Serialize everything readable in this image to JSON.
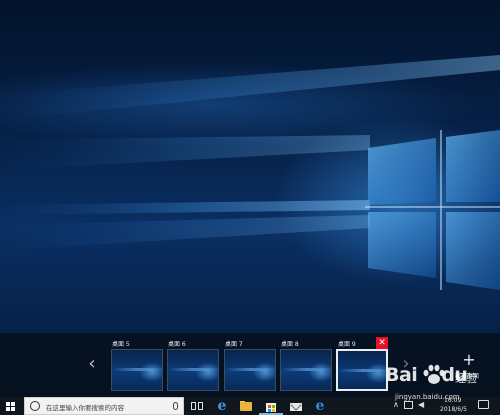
{
  "task_view": {
    "desktops": [
      {
        "label": "桌面 5",
        "selected": false
      },
      {
        "label": "桌面 6",
        "selected": false
      },
      {
        "label": "桌面 7",
        "selected": false
      },
      {
        "label": "桌面 8",
        "selected": false
      },
      {
        "label": "桌面 9",
        "selected": true
      }
    ],
    "close_glyph": "✕",
    "prev_arrow": "‹",
    "next_arrow": "›",
    "new_desktop_plus": "+",
    "new_desktop_label": "新建桌面"
  },
  "taskbar": {
    "search_placeholder": "在这里输入你要搜索的内容",
    "icons": [
      "windows-start-icon",
      "search-icon",
      "microphone-icon",
      "task-view-icon",
      "edge-icon",
      "file-explorer-icon",
      "store-icon",
      "mail-icon",
      "ie-icon"
    ],
    "tray_chevron": "∧",
    "tray_speaker": "◀",
    "clock_time": "16:09",
    "clock_date": "2018/6/5"
  },
  "watermark": {
    "logo": "Bai",
    "logo_suffix": "du",
    "sub": "经验",
    "url": "jingyan.baidu.com"
  },
  "colors": {
    "close_button": "#e81123",
    "taskbar": "#10161e",
    "wallpaper_accent": "#3b9ce8"
  }
}
